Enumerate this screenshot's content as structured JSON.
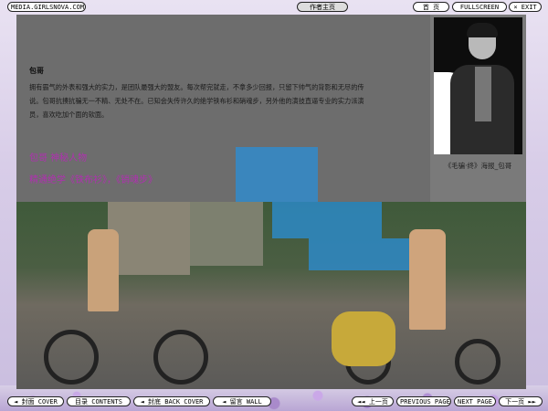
{
  "top_bar": {
    "site": "MEDIA.GIRLSNOVA.COM",
    "center_button": "作者主页",
    "right_buttons": [
      "首 页",
      "FULLSCREEN",
      "× EXIT"
    ]
  },
  "profile": {
    "name": "包哥",
    "bio": "拥有霸气的外表和强大的实力，是团队最强大的盟友。每次帮完就走，不拿多少回报，只留下帅气的背影和无尽的传说。包哥抗揍抗骗无一不精、无处不在。已知会失传许久的绝学铁布衫和硝魂步，另外他的演技直逼专业的实力派演员，喜欢吃加个面的软面。",
    "line1": "包哥  神秘人物",
    "line2": "精通绝学《铁布衫》，《销魂步》",
    "photo_caption": "《毛骗·终》海报_包哥"
  },
  "bottom_bar": {
    "left_buttons": [
      "◄ 封面 COVER",
      "目录 CONTENTS",
      "◄ 封底 BACK COVER",
      "◄ 留言 WALL"
    ],
    "right_buttons": [
      "◄◄ 上一页",
      "PREVIOUS PAGE",
      "NEXT PAGE",
      "下一页 ►►"
    ]
  },
  "colors": {
    "accent_purple": "#b030b0",
    "page_bg": "#6d6d6d",
    "pixel_blue": "#2a8fd8"
  }
}
